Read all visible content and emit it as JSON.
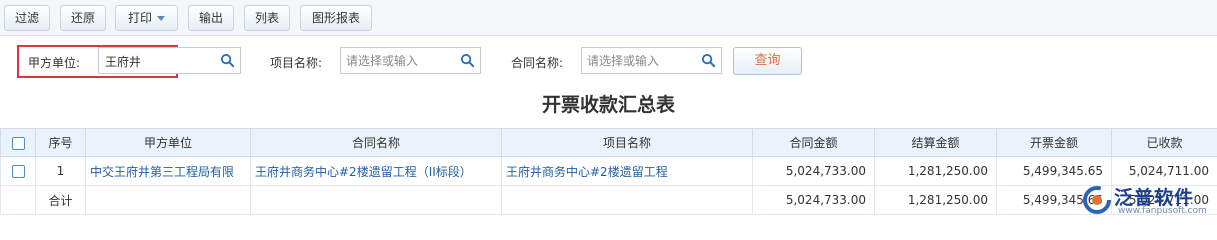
{
  "toolbar": {
    "filter": "过滤",
    "restore": "还原",
    "print": "打印",
    "export": "输出",
    "list": "列表",
    "chart_report": "图形报表"
  },
  "filters": {
    "party_a": {
      "label": "甲方单位:",
      "value": "王府井"
    },
    "project": {
      "label": "项目名称:",
      "placeholder": "请选择或输入"
    },
    "contract": {
      "label": "合同名称:",
      "placeholder": "请选择或输入"
    },
    "query": "查询"
  },
  "report_title": "开票收款汇总表",
  "table": {
    "headers": [
      "序号",
      "甲方单位",
      "合同名称",
      "项目名称",
      "合同金额",
      "结算金额",
      "开票金额",
      "已收款"
    ],
    "rows": [
      {
        "index": "1",
        "party_a": "中交王府井第三工程局有限",
        "contract": "王府井商务中心#2楼遗留工程（II标段）",
        "project": "王府井商务中心#2楼遗留工程",
        "contract_amount": "5,024,733.00",
        "settlement_amount": "1,281,250.00",
        "invoice_amount": "5,499,345.65",
        "received": "5,024,711.00"
      }
    ],
    "total": {
      "label": "合计",
      "contract_amount": "5,024,733.00",
      "settlement_amount": "1,281,250.00",
      "invoice_amount": "5,499,345.65",
      "received": "5,024,711.00"
    }
  },
  "watermark": {
    "text": "泛普软件",
    "url": "www.fanpusoft.com"
  },
  "colors": {
    "accent": "#1f5fa8",
    "highlight_border": "#d9363e",
    "query_text": "#e0733a"
  }
}
